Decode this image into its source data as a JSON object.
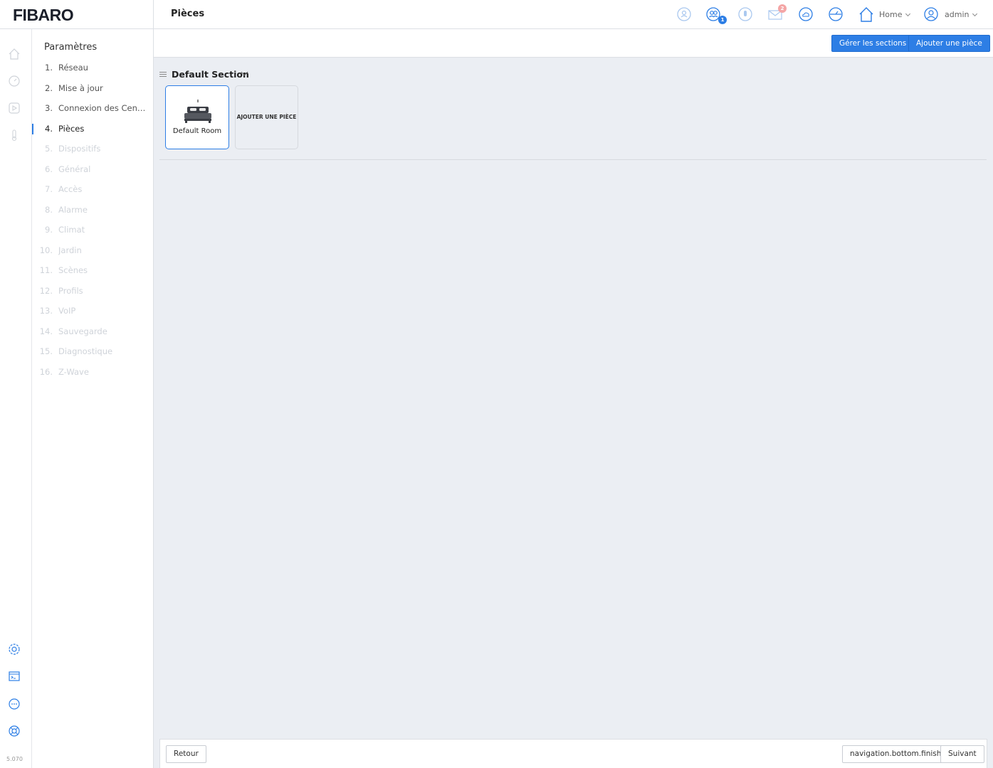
{
  "app": {
    "logo": "FIBARO",
    "version": "5.070"
  },
  "header": {
    "page_title": "Pièces",
    "users_badge": "1",
    "messages_badge": "2",
    "home_label": "Home",
    "user_label": "admin"
  },
  "sidebar": {
    "title": "Paramètres",
    "steps": [
      {
        "num": "1.",
        "label": "Réseau",
        "state": "done"
      },
      {
        "num": "2.",
        "label": "Mise à jour",
        "state": "done"
      },
      {
        "num": "3.",
        "label": "Connexion des Centr...",
        "state": "done"
      },
      {
        "num": "4.",
        "label": "Pièces",
        "state": "active"
      },
      {
        "num": "5.",
        "label": "Dispositifs",
        "state": "todo"
      },
      {
        "num": "6.",
        "label": "Général",
        "state": "todo"
      },
      {
        "num": "7.",
        "label": "Accès",
        "state": "todo"
      },
      {
        "num": "8.",
        "label": "Alarme",
        "state": "todo"
      },
      {
        "num": "9.",
        "label": "Climat",
        "state": "todo"
      },
      {
        "num": "10.",
        "label": "Jardin",
        "state": "todo"
      },
      {
        "num": "11.",
        "label": "Scènes",
        "state": "todo"
      },
      {
        "num": "12.",
        "label": "Profils",
        "state": "todo"
      },
      {
        "num": "13.",
        "label": "VoIP",
        "state": "todo"
      },
      {
        "num": "14.",
        "label": "Sauvegarde",
        "state": "todo"
      },
      {
        "num": "15.",
        "label": "Diagnostique",
        "state": "todo"
      },
      {
        "num": "16.",
        "label": "Z-Wave",
        "state": "todo"
      }
    ]
  },
  "actions": {
    "manage_sections": "Gérer les sections",
    "add_room": "Ajouter une pièce"
  },
  "section": {
    "name": "Default Section",
    "rooms": [
      {
        "name": "Default Room"
      }
    ],
    "add_room_card": "AJOUTER UNE PIÈCE"
  },
  "footer": {
    "back": "Retour",
    "finish": "navigation.bottom.finish",
    "next": "Suivant"
  },
  "colors": {
    "accent": "#2d7ee5",
    "background": "#ebeef3",
    "badge_red": "#f08080"
  }
}
